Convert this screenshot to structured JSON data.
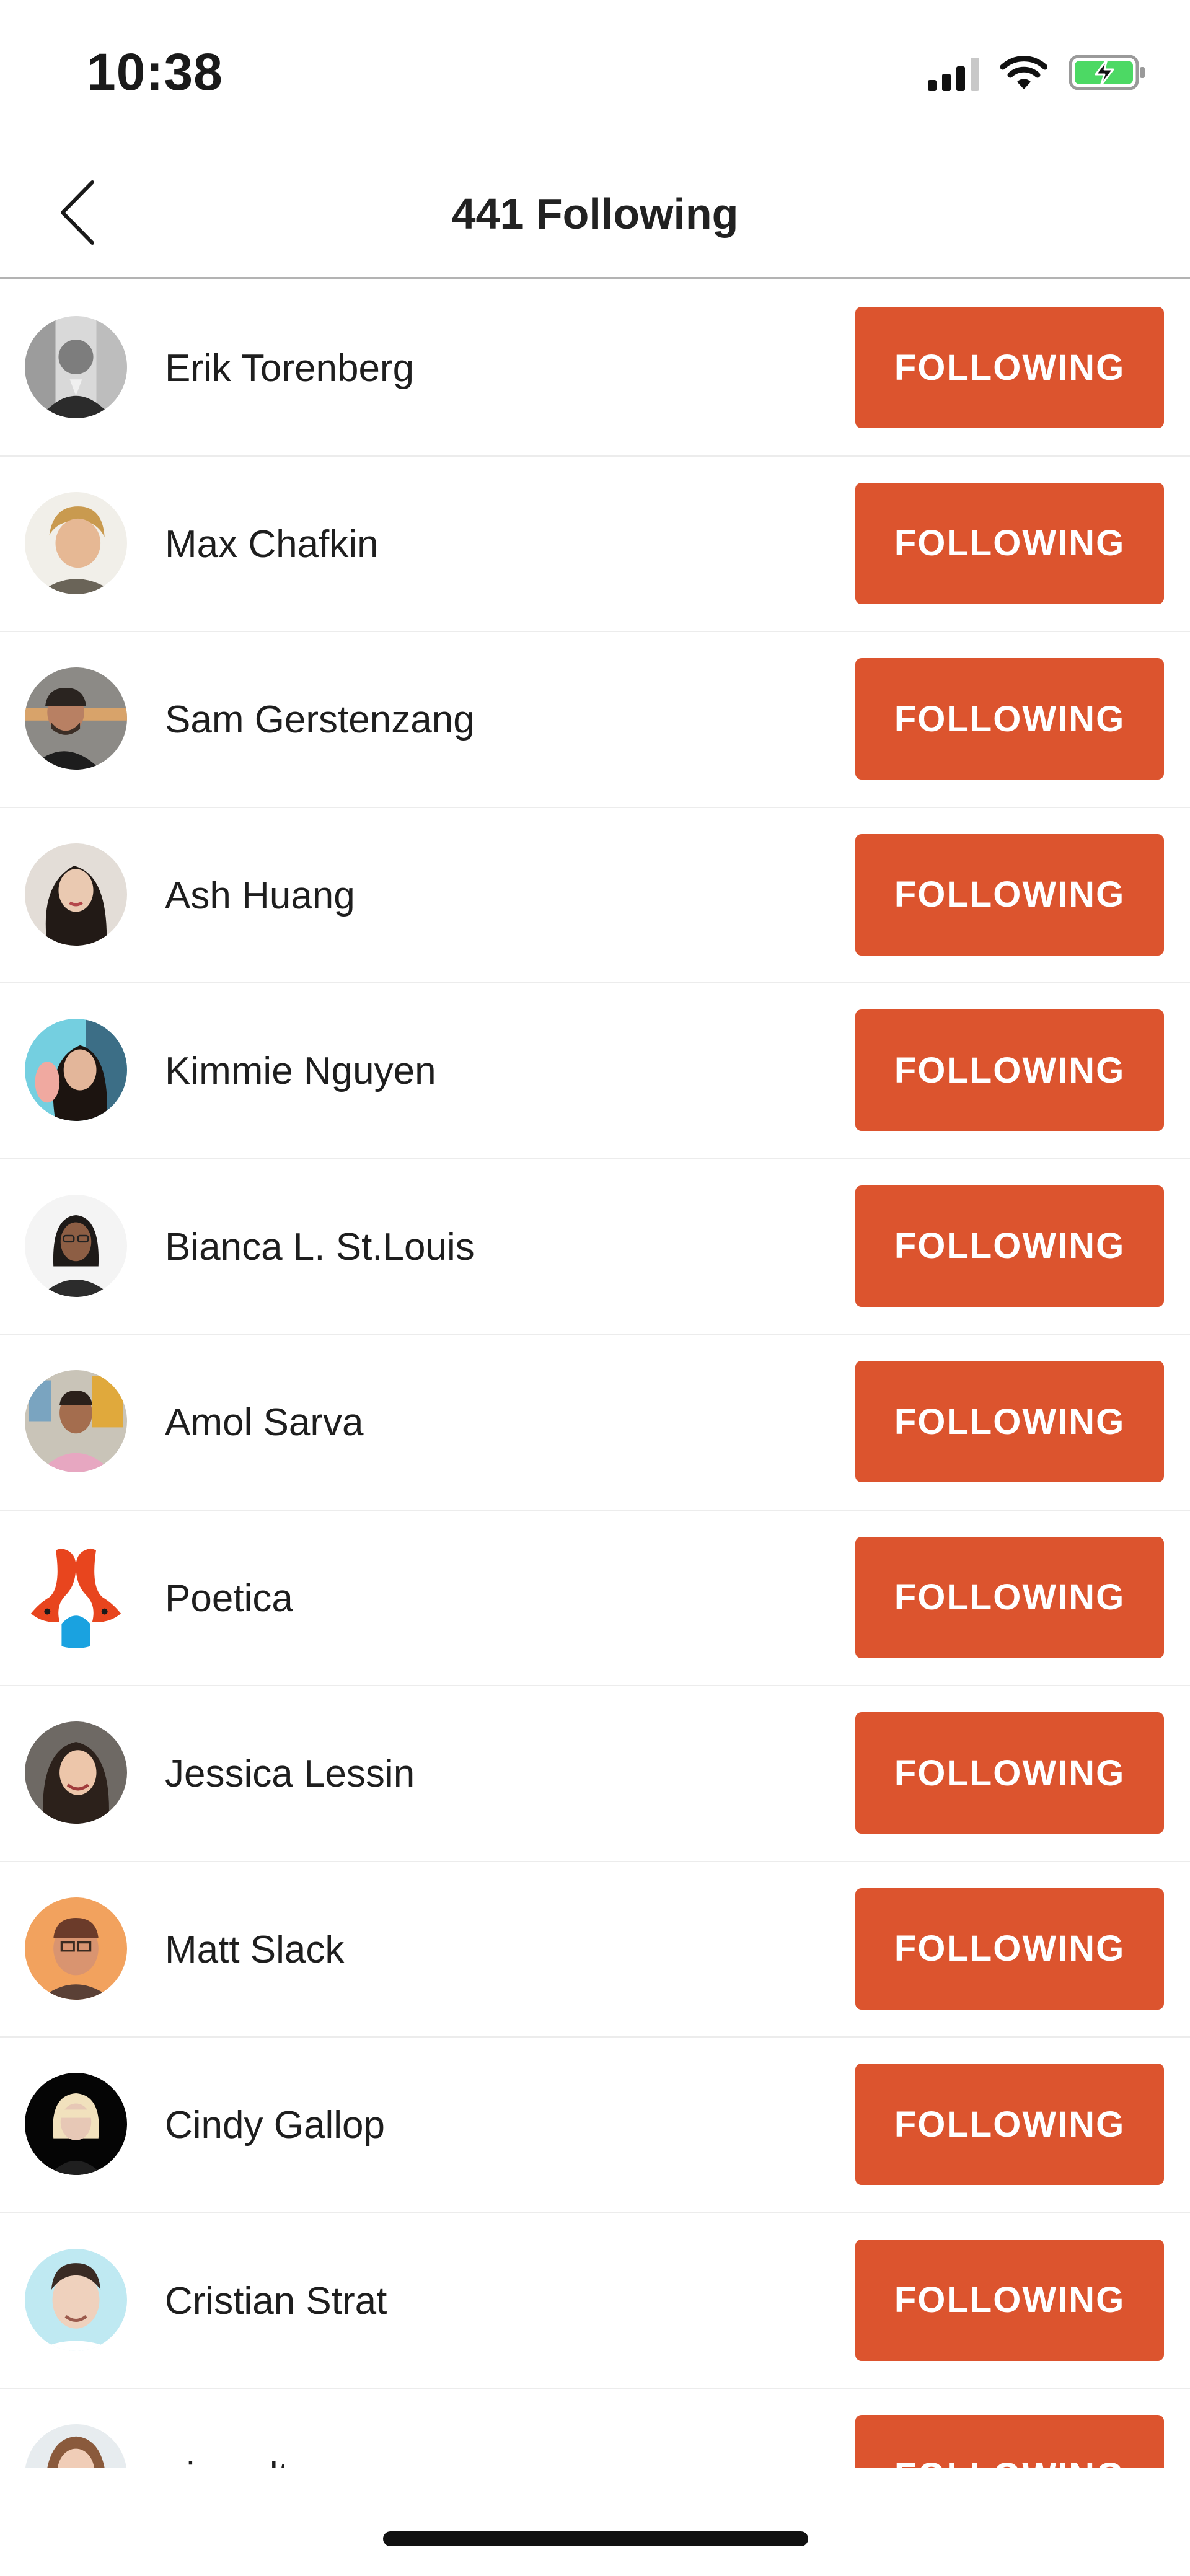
{
  "status_bar": {
    "time": "10:38",
    "icons": [
      "signal-icon",
      "wifi-icon",
      "battery-charging-icon"
    ],
    "battery_color": "#4cd964"
  },
  "header": {
    "title": "441 Following",
    "back_icon": "chevron-left-icon"
  },
  "theme": {
    "accent": "#dc542e",
    "divider": "#ececec"
  },
  "following": [
    {
      "name": "Erik Torenberg",
      "button": "FOLLOWING"
    },
    {
      "name": "Max Chafkin",
      "button": "FOLLOWING"
    },
    {
      "name": "Sam Gerstenzang",
      "button": "FOLLOWING"
    },
    {
      "name": "Ash Huang",
      "button": "FOLLOWING"
    },
    {
      "name": "Kimmie Nguyen",
      "button": "FOLLOWING"
    },
    {
      "name": "Bianca L. St.Louis",
      "button": "FOLLOWING"
    },
    {
      "name": "Amol Sarva",
      "button": "FOLLOWING"
    },
    {
      "name": "Poetica",
      "button": "FOLLOWING"
    },
    {
      "name": "Jessica Lessin",
      "button": "FOLLOWING"
    },
    {
      "name": "Matt Slack",
      "button": "FOLLOWING"
    },
    {
      "name": "Cindy Gallop",
      "button": "FOLLOWING"
    },
    {
      "name": "Cristian Strat",
      "button": "FOLLOWING"
    },
    {
      "name": "nina alter",
      "button": "FOLLOWING"
    }
  ]
}
